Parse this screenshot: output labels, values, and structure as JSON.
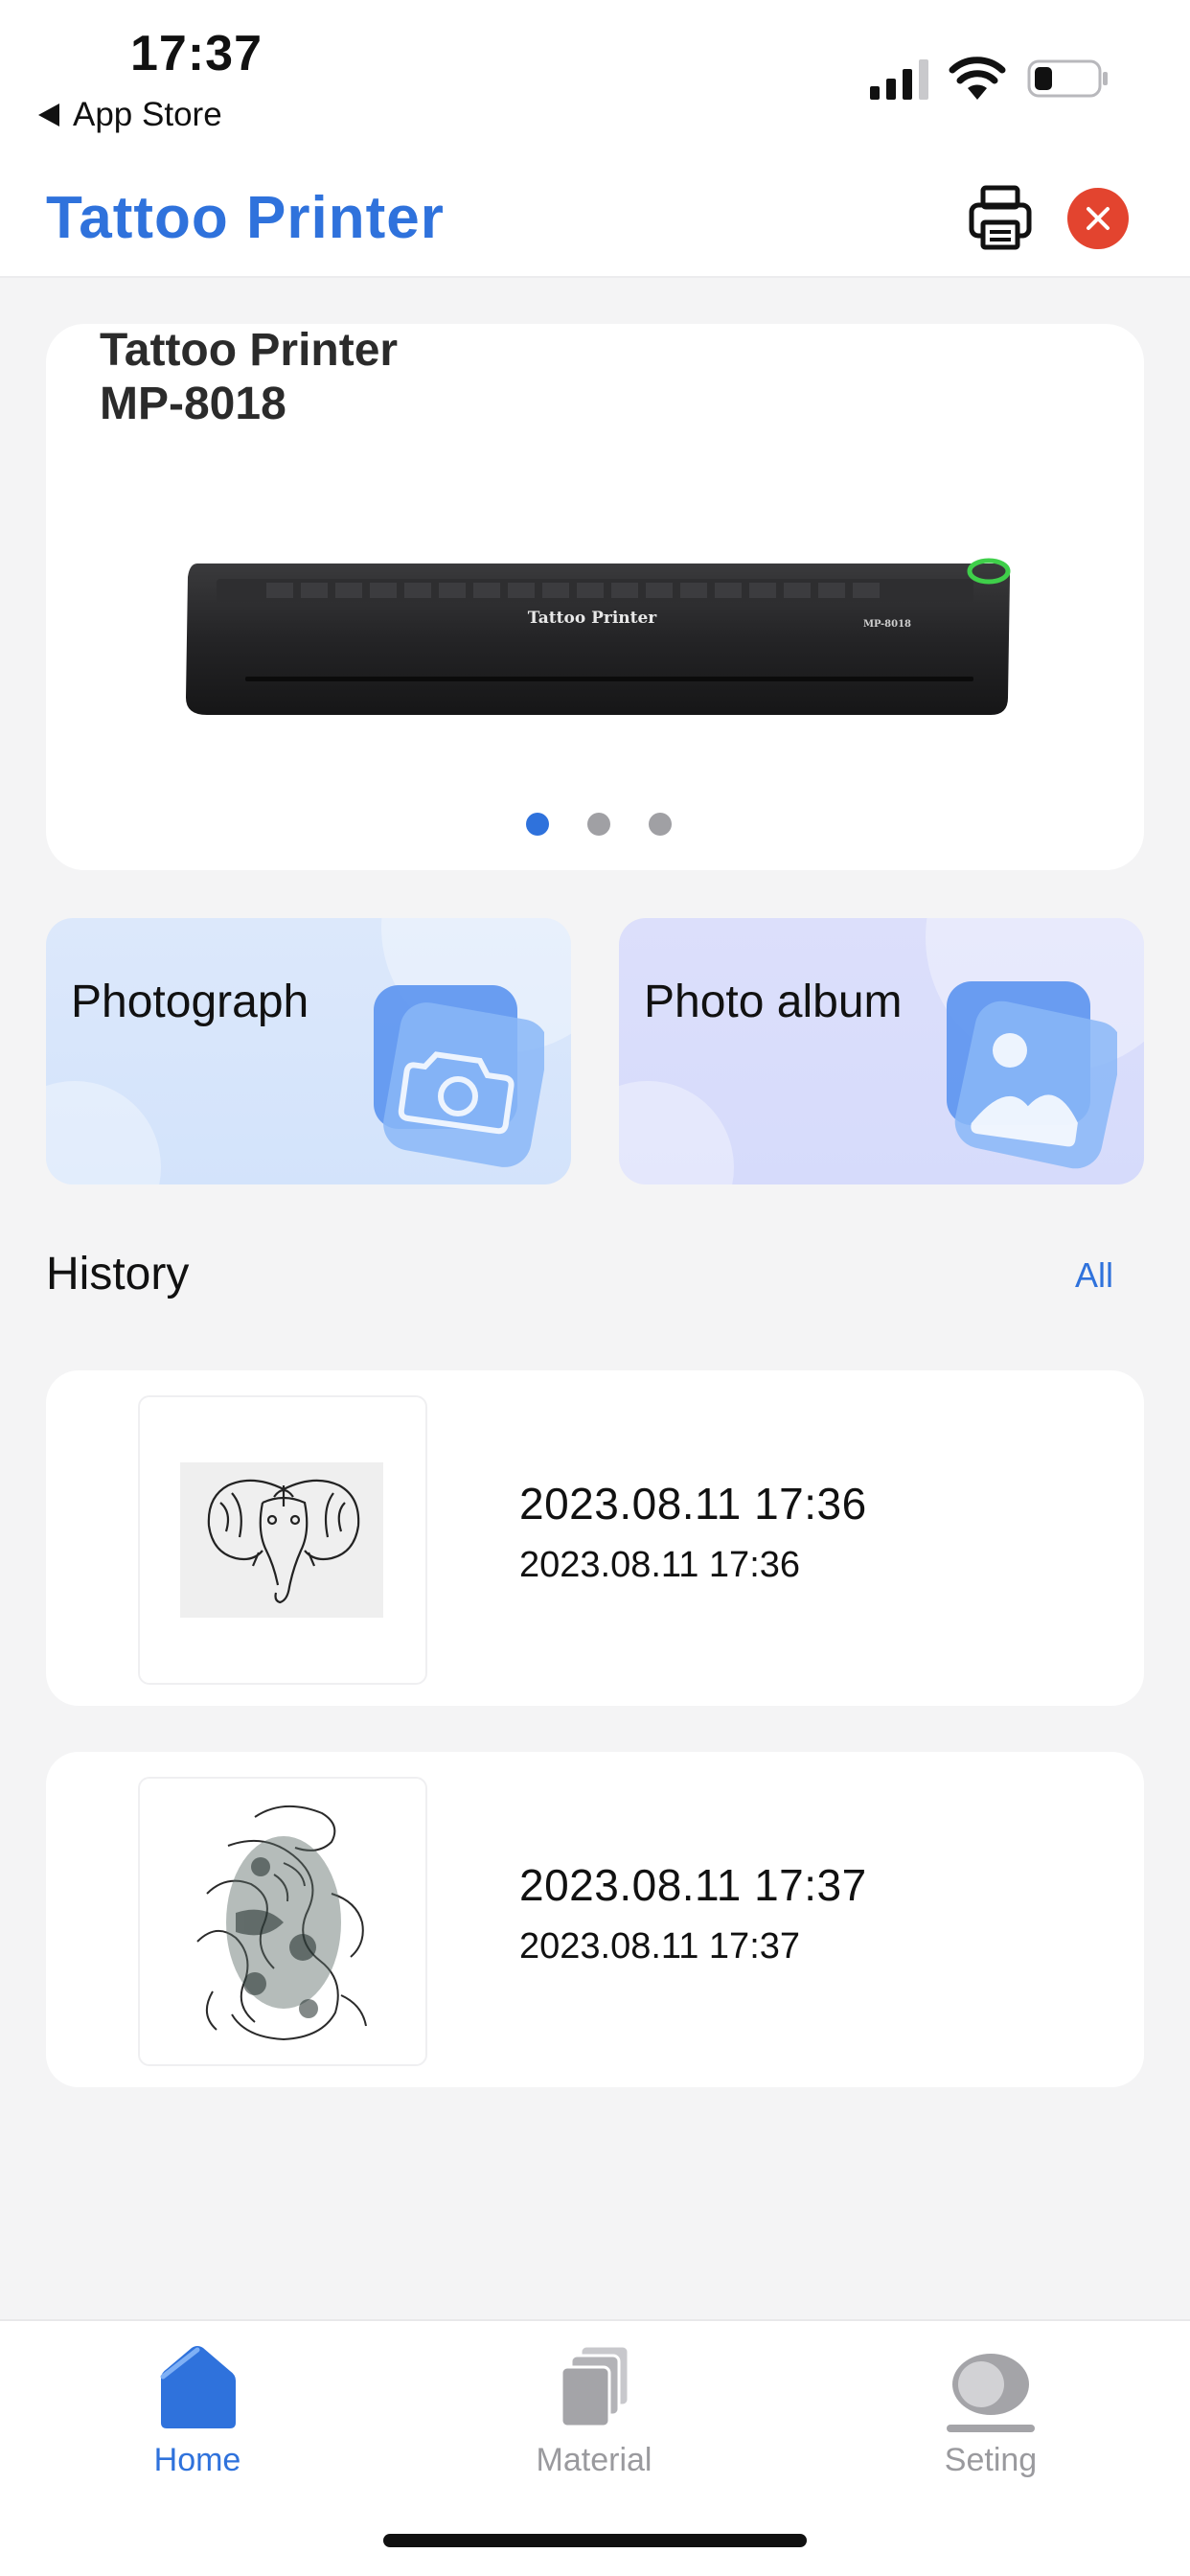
{
  "status_bar": {
    "time": "17:37",
    "back_label": "App Store"
  },
  "header": {
    "title": "Tattoo Printer"
  },
  "banner": {
    "title_line1": "Tattoo Printer",
    "title_line2": "MP-8018",
    "device_label": "Tattoo Printer",
    "device_model": "MP-8018",
    "slide_count": 3,
    "active_slide": 1
  },
  "actions": [
    {
      "label": "Photograph",
      "icon": "camera-icon"
    },
    {
      "label": "Photo album",
      "icon": "image-icon"
    }
  ],
  "history": {
    "title": "History",
    "all_label": "All",
    "items": [
      {
        "title": "2023.08.11 17:36",
        "subtitle": "2023.08.11 17:36",
        "thumbnail": "elephant-tattoo"
      },
      {
        "title": "2023.08.11 17:37",
        "subtitle": "2023.08.11 17:37",
        "thumbnail": "dragon-tattoo"
      }
    ]
  },
  "tabs": [
    {
      "label": "Home",
      "icon": "home-icon",
      "active": true
    },
    {
      "label": "Material",
      "icon": "layers-icon",
      "active": false
    },
    {
      "label": "Seting",
      "icon": "settings-icon",
      "active": false
    }
  ],
  "colors": {
    "accent": "#2f72dc",
    "close": "#e3442f",
    "background": "#f4f4f5"
  }
}
